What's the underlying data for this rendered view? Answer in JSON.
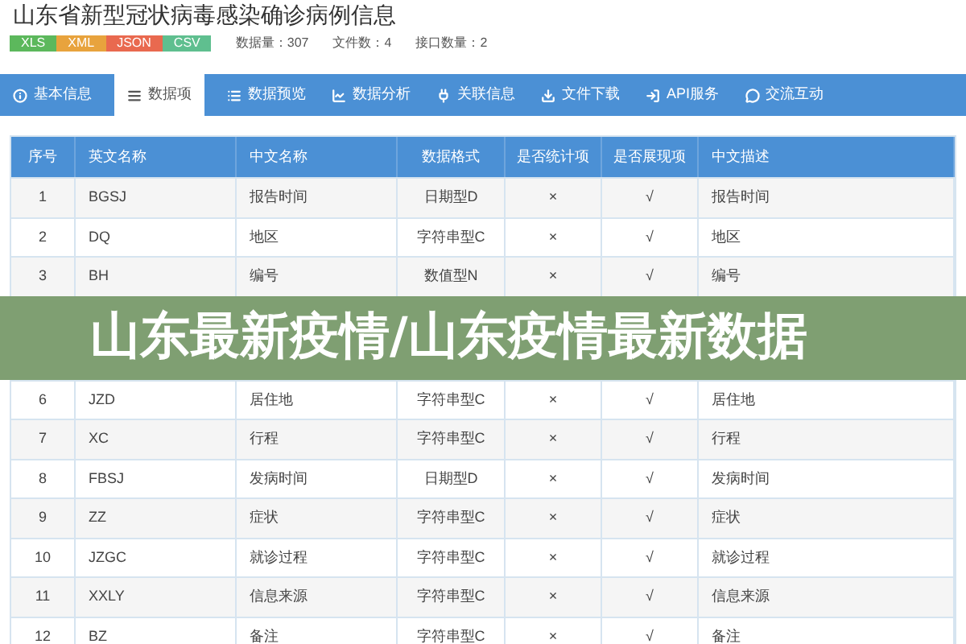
{
  "page_title": "山东省新型冠状病毒感染确诊病例信息",
  "formats": [
    {
      "label": "XLS",
      "color": "#5cb85c"
    },
    {
      "label": "XML",
      "color": "#e8a33d"
    },
    {
      "label": "JSON",
      "color": "#e9694f"
    },
    {
      "label": "CSV",
      "color": "#5fbf8f"
    }
  ],
  "stats": [
    "数据量：307",
    "文件数：4",
    "接口数量：2"
  ],
  "tabs": [
    {
      "label": "基本信息",
      "selected": false
    },
    {
      "label": "数据项",
      "selected": true
    },
    {
      "label": "数据预览",
      "selected": false
    },
    {
      "label": "数据分析",
      "selected": false
    },
    {
      "label": "关联信息",
      "selected": false
    },
    {
      "label": "文件下载",
      "selected": false
    },
    {
      "label": "API服务",
      "selected": false
    },
    {
      "label": "交流互动",
      "selected": false
    }
  ],
  "table": {
    "columns": [
      "序号",
      "英文名称",
      "中文名称",
      "数据格式",
      "是否统计项",
      "是否展现项",
      "中文描述"
    ],
    "rows": [
      {
        "no": "1",
        "en": "BGSJ",
        "cn": "报告时间",
        "format": "日期型D",
        "stat": "×",
        "show": "√",
        "desc": "报告时间"
      },
      {
        "no": "2",
        "en": "DQ",
        "cn": "地区",
        "format": "字符串型C",
        "stat": "×",
        "show": "√",
        "desc": "地区"
      },
      {
        "no": "3",
        "en": "BH",
        "cn": "编号",
        "format": "数值型N",
        "stat": "×",
        "show": "√",
        "desc": "编号"
      },
      {
        "no": "6",
        "en": "JZD",
        "cn": "居住地",
        "format": "字符串型C",
        "stat": "×",
        "show": "√",
        "desc": "居住地"
      },
      {
        "no": "7",
        "en": "XC",
        "cn": "行程",
        "format": "字符串型C",
        "stat": "×",
        "show": "√",
        "desc": "行程"
      },
      {
        "no": "8",
        "en": "FBSJ",
        "cn": "发病时间",
        "format": "日期型D",
        "stat": "×",
        "show": "√",
        "desc": "发病时间"
      },
      {
        "no": "9",
        "en": "ZZ",
        "cn": "症状",
        "format": "字符串型C",
        "stat": "×",
        "show": "√",
        "desc": "症状"
      },
      {
        "no": "10",
        "en": "JZGC",
        "cn": "就诊过程",
        "format": "字符串型C",
        "stat": "×",
        "show": "√",
        "desc": "就诊过程"
      },
      {
        "no": "11",
        "en": "XXLY",
        "cn": "信息来源",
        "format": "字符串型C",
        "stat": "×",
        "show": "√",
        "desc": "信息来源"
      },
      {
        "no": "12",
        "en": "BZ",
        "cn": "备注",
        "format": "字符串型C",
        "stat": "×",
        "show": "√",
        "desc": "备注"
      }
    ]
  },
  "overlay_title": "山东最新疫情/山东疫情最新数据"
}
